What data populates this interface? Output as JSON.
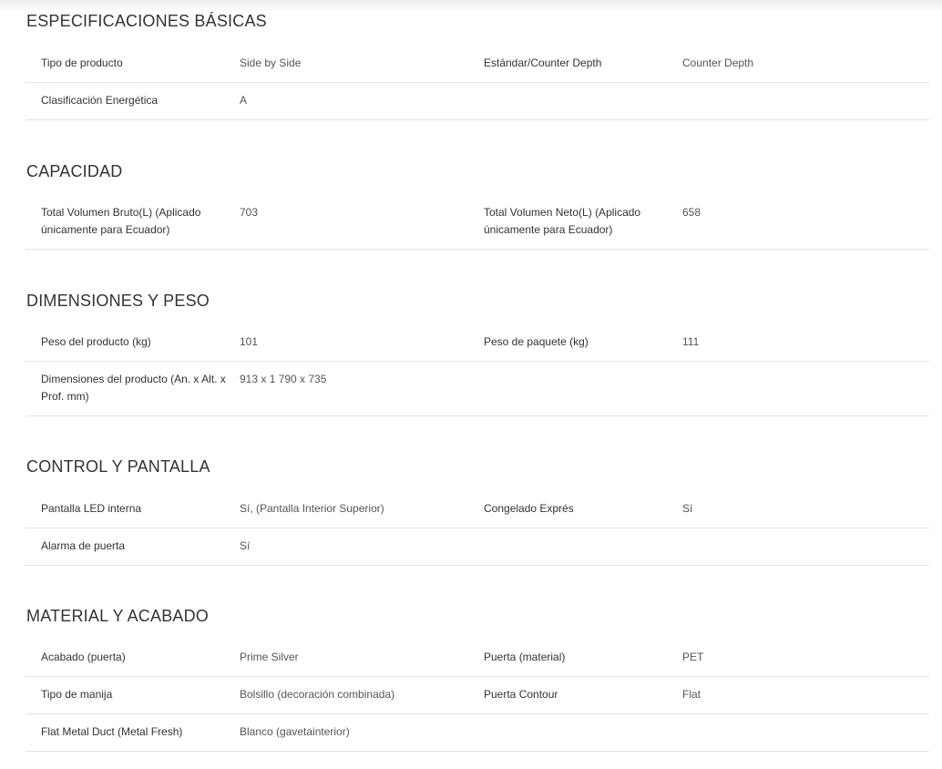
{
  "sections": [
    {
      "title": "ESPECIFICACIONES BÁSICAS",
      "rows": [
        {
          "label1": "Tipo de producto",
          "value1": "Side by Side",
          "label2": "Estándar/Counter Depth",
          "value2": "Counter Depth"
        },
        {
          "label1": "Clasificación Energética",
          "value1": "A",
          "label2": "",
          "value2": ""
        }
      ]
    },
    {
      "title": "CAPACIDAD",
      "rows": [
        {
          "label1": "Total Volumen Bruto(L) (Aplicado únicamente para Ecuador)",
          "value1": "703",
          "label2": "Total Volumen Neto(L) (Aplicado únicamente para Ecuador)",
          "value2": "658"
        }
      ]
    },
    {
      "title": "DIMENSIONES Y PESO",
      "rows": [
        {
          "label1": "Peso del producto (kg)",
          "value1": "101",
          "label2": "Peso de paquete (kg)",
          "value2": "111"
        },
        {
          "label1": "Dimensiones del producto (An. x Alt. x Prof. mm)",
          "value1": "913 x 1 790 x 735",
          "label2": "",
          "value2": ""
        }
      ]
    },
    {
      "title": "CONTROL Y PANTALLA",
      "rows": [
        {
          "label1": "Pantalla LED interna",
          "value1": "Sí, (Pantalla Interior Superior)",
          "label2": "Congelado Exprés",
          "value2": "Sí"
        },
        {
          "label1": "Alarma de puerta",
          "value1": "Sí",
          "label2": "",
          "value2": ""
        }
      ]
    },
    {
      "title": "MATERIAL Y ACABADO",
      "rows": [
        {
          "label1": "Acabado (puerta)",
          "value1": "Prime Silver",
          "label2": "Puerta (material)",
          "value2": "PET"
        },
        {
          "label1": "Tipo de manija",
          "value1": "Bolsillo (decoración combinada)",
          "label2": "Puerta Contour",
          "value2": "Flat"
        },
        {
          "label1": "Flat Metal Duct (Metal Fresh)",
          "value1": "Blanco (gavetainterior)",
          "label2": "",
          "value2": ""
        }
      ]
    }
  ]
}
